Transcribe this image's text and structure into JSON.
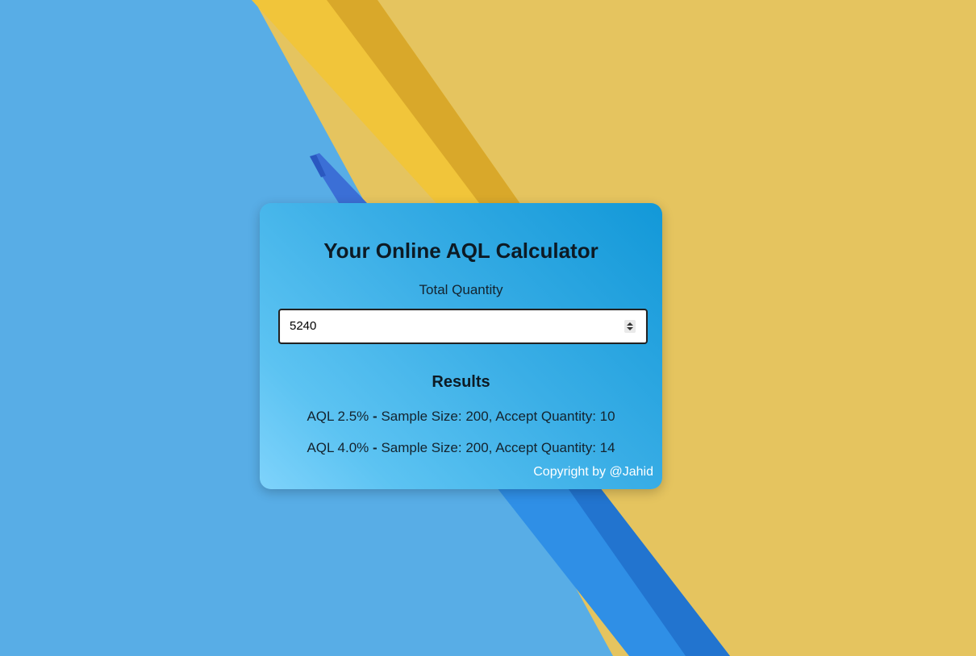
{
  "page": {
    "title": "Your Online AQL Calculator"
  },
  "form": {
    "quantity_label": "Total Quantity",
    "quantity_value": "5240"
  },
  "results": {
    "heading": "Results",
    "items": [
      {
        "aql": "AQL 2.5%",
        "separator": "-",
        "detail": "Sample Size: 200, Accept Quantity: 10"
      },
      {
        "aql": "AQL 4.0%",
        "separator": "-",
        "detail": "Sample Size: 200, Accept Quantity: 14"
      }
    ]
  },
  "footer": {
    "copyright": "Copyright by @Jahid"
  },
  "icons": {
    "spinner": "number-spinner-icon"
  },
  "colors": {
    "card_gradient_start": "#1298d8",
    "card_gradient_end": "#7fd3fb",
    "background_blue": "#56aee6",
    "background_yellow": "#e6c45e"
  }
}
